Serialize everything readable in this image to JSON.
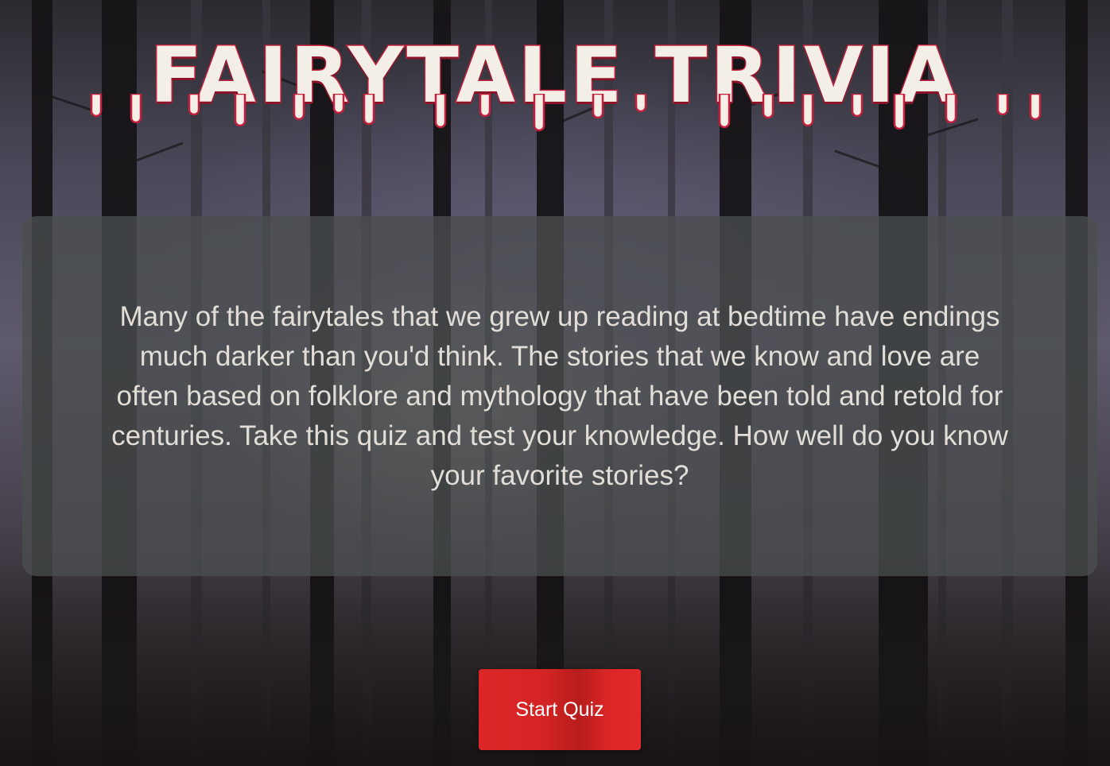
{
  "page": {
    "title": "FAIRYTALE TRIVIA",
    "intro_text": "Many of the fairytales that we grew up reading at bedtime have endings much darker than you'd think. The stories that we know and love are often based on folklore and mythology that have been told and retold for centuries. Take this quiz and test your knowledge. How well do you know your favorite stories?",
    "start_button_label": "Start Quiz"
  },
  "colors": {
    "title_fill": "#f3eee6",
    "title_outline": "#c41f3d",
    "card_background": "rgba(74,78,80,0.78)",
    "intro_text": "#e2ddd7",
    "button_background": "#dc2626",
    "button_text": "#ffffff"
  },
  "background": {
    "icon": "dark-forest-image"
  }
}
